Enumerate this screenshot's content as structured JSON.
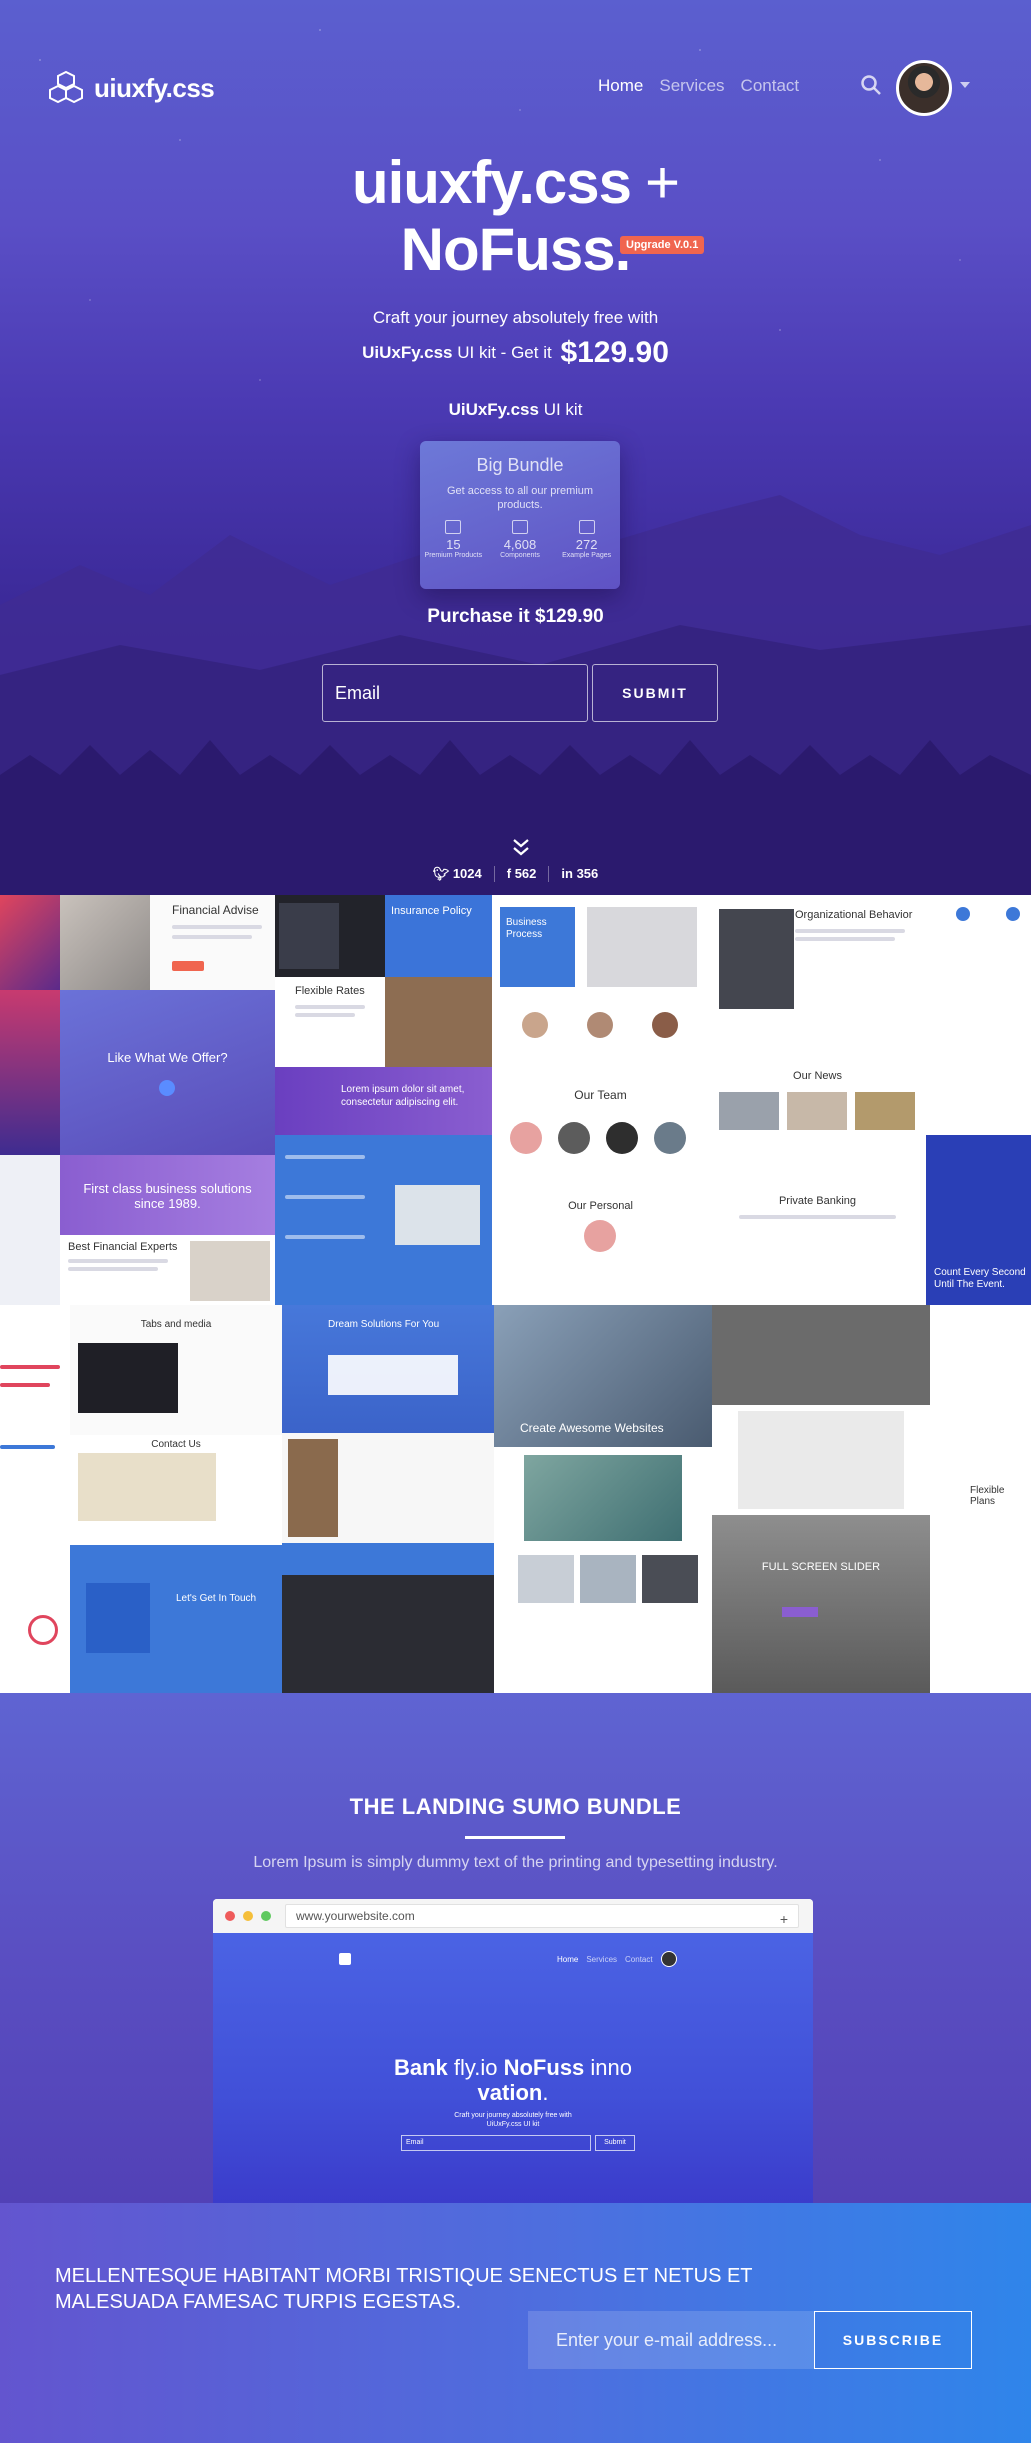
{
  "app": {
    "logo_text": "uiuxfy.css"
  },
  "nav": {
    "items": [
      "Home",
      "Services",
      "Contact"
    ],
    "active": "Home"
  },
  "hero": {
    "title_line1": "uiuxfy.css",
    "title_plus": "+",
    "title_line2": "NoFuss",
    "title_dot": ".",
    "badge": "Upgrade V.0.1",
    "subtitle": "Craft your journey absolutely free with",
    "kit_brand": "UiUxFy.css",
    "kit_suffix": "UI kit - Get it",
    "price": "$129.90",
    "kit_line_brand": "UiUxFy.css",
    "kit_line_suffix": "UI kit",
    "purchase": "Purchase it $129.90",
    "email_placeholder": "Email",
    "submit_label": "SUBMIT"
  },
  "bundle": {
    "title": "Big Bundle",
    "desc": "Get access to all our premium products.",
    "stats": [
      {
        "num": "15",
        "label": "Premium Products"
      },
      {
        "num": "4,608",
        "label": "Components"
      },
      {
        "num": "272",
        "label": "Example Pages"
      }
    ]
  },
  "social": {
    "twitter": "1024",
    "facebook": "562",
    "linkedin": "356"
  },
  "collage": {
    "financial_advise": "Financial Advise",
    "what_we_offer": "Like What We Offer?",
    "first_class": "First class business solutions since 1989.",
    "best_financial": "Best Financial Experts",
    "insurance_policy": "Insurance Policy",
    "flexible_rates": "Flexible Rates",
    "lorem_ipsum": "Lorem ipsum dolor sit amet, consectetur adipiscing elit.",
    "business_process": "Business Process",
    "our_team": "Our Team",
    "our_personal": "Our Personal",
    "org_behavior": "Organizational Behavior",
    "our_news": "Our News",
    "private_banking": "Private Banking",
    "count_every_second": "Count Every Second Until The Event.",
    "tabs_media": "Tabs and media",
    "contact_us": "Contact Us",
    "lets_get_in_touch": "Let's Get In Touch",
    "dream_solutions": "Dream Solutions For You",
    "create_websites": "Create Awesome Websites",
    "full_screen_slider": "FULL SCREEN SLIDER",
    "flexible_plans": "Flexible Plans"
  },
  "sumo": {
    "title": "THE LANDING SUMO BUNDLE",
    "desc": "Lorem Ipsum is simply dummy text of the printing and typesetting industry.",
    "url": "www.yourwebsite.com",
    "shot_menu": [
      "Home",
      "Services",
      "Contact"
    ],
    "shot_title_1a": "Bank",
    "shot_title_1b": " fly.io ",
    "shot_title_1c": "NoFuss",
    "shot_title_1d": " inno",
    "shot_title_2a": "vation",
    "shot_title_2b": ".",
    "shot_sub1": "Craft your journey absolutely free with",
    "shot_sub2": "UiUxFy.css UI kit",
    "shot_email": "Email",
    "shot_submit": "Submit"
  },
  "cta": {
    "text": "MELLENTESQUE HABITANT MORBI TRISTIQUE SENECTUS ET NETUS ET MALESUADA FAMESAC TURPIS EGESTAS.",
    "placeholder": "Enter your e-mail address...",
    "button": "SUBSCRIBE"
  },
  "colors": {
    "accent": "#5b4fc6",
    "badge": "#f0654f",
    "cta_end": "#2f85ea"
  },
  "icons": [
    "logo-cube-icon",
    "search-icon",
    "twitter-icon",
    "facebook-icon",
    "linkedin-icon",
    "chevron-down-icon"
  ]
}
